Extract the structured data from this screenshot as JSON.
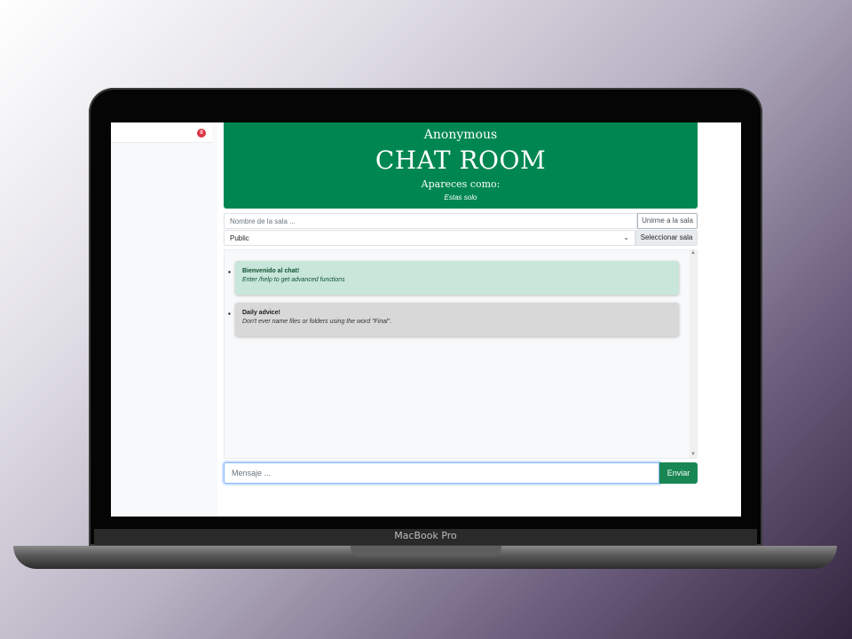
{
  "header": {
    "username": "Anonymous",
    "title": "CHAT ROOM",
    "appear_as": "Apareces como:",
    "alone": "Estas solo"
  },
  "sidebar": {
    "badge_count": "0"
  },
  "room": {
    "name_placeholder": "Nombre de la sala ...",
    "join_label": "Unirme a la sala",
    "selected_room": "Public",
    "select_label": "Seleccionar sala"
  },
  "messages": [
    {
      "title": "Bienvenido al chat!",
      "text": "Enter /help to get advanced functions"
    },
    {
      "title": "Daily advice!",
      "text": "Don't ever name files or folders using the word \"Final\"."
    }
  ],
  "composer": {
    "placeholder": "Mensaje ...",
    "send_label": "Enviar"
  },
  "device": {
    "label": "MacBook Pro"
  },
  "colors": {
    "header_green": "#008751",
    "send_green": "#198754",
    "welcome_bg": "#c8e6d9",
    "advice_bg": "#d8d8d8",
    "badge_red": "#dc3545"
  }
}
